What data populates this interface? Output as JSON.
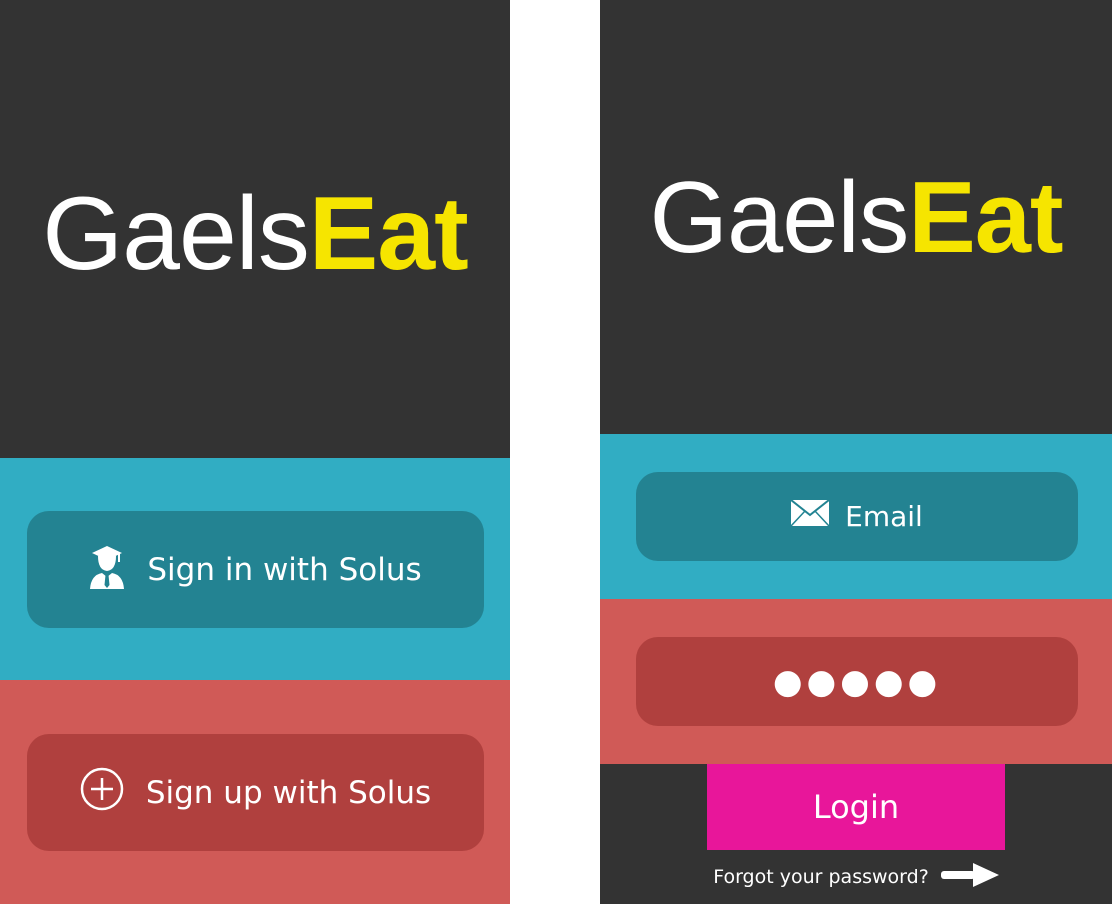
{
  "colors": {
    "dark_bg": "#333333",
    "teal": "#31adc3",
    "teal_button": "#238392",
    "red": "#d05a57",
    "red_button": "#b0403e",
    "login_pink": "#e8169a",
    "logo_white": "#ffffff",
    "logo_yellow": "#f6e500"
  },
  "welcome_screen": {
    "logo": {
      "part1": "Gaels",
      "part2": "Eat"
    },
    "signin_button": {
      "icon": "graduate-icon",
      "label": "Sign in with Solus"
    },
    "signup_button": {
      "icon": "plus-circle-icon",
      "label": "Sign up with Solus"
    }
  },
  "login_screen": {
    "logo": {
      "part1": "Gaels",
      "part2": "Eat"
    },
    "email_field": {
      "icon": "envelope-icon",
      "placeholder": "Email"
    },
    "password_field": {
      "value": "●●●●●"
    },
    "login_button": {
      "label": "Login"
    },
    "forgot_link": {
      "label": "Forgot your password?",
      "icon": "arrow-right-icon"
    }
  }
}
